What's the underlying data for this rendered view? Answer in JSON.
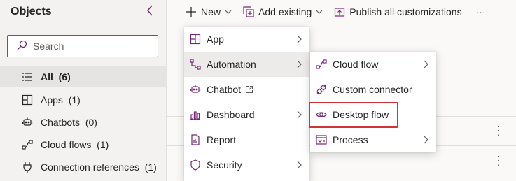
{
  "left_panel": {
    "title": "Objects",
    "search_placeholder": "Search",
    "items": [
      {
        "label": "All",
        "count": "(6)",
        "icon": "list-icon"
      },
      {
        "label": "Apps",
        "count": "(1)",
        "icon": "apps-icon"
      },
      {
        "label": "Chatbots",
        "count": "(0)",
        "icon": "chatbot-icon"
      },
      {
        "label": "Cloud flows",
        "count": "(1)",
        "icon": "cloud-flow-icon"
      },
      {
        "label": "Connection references",
        "count": "(1)",
        "icon": "plug-icon"
      }
    ]
  },
  "command_bar": {
    "new_label": "New",
    "add_existing_label": "Add existing",
    "publish_label": "Publish all customizations",
    "more_label": "···"
  },
  "new_menu": {
    "items": [
      {
        "label": "App",
        "has_submenu": true
      },
      {
        "label": "Automation",
        "has_submenu": true
      },
      {
        "label": "Chatbot",
        "has_submenu": false
      },
      {
        "label": "Dashboard",
        "has_submenu": true
      },
      {
        "label": "Report",
        "has_submenu": false
      },
      {
        "label": "Security",
        "has_submenu": true
      }
    ]
  },
  "automation_menu": {
    "items": [
      {
        "label": "Cloud flow",
        "has_submenu": true
      },
      {
        "label": "Custom connector",
        "has_submenu": false
      },
      {
        "label": "Desktop flow",
        "has_submenu": false
      },
      {
        "label": "Process",
        "has_submenu": true
      }
    ]
  },
  "colors": {
    "accent": "#742774",
    "highlight": "#d13438"
  }
}
